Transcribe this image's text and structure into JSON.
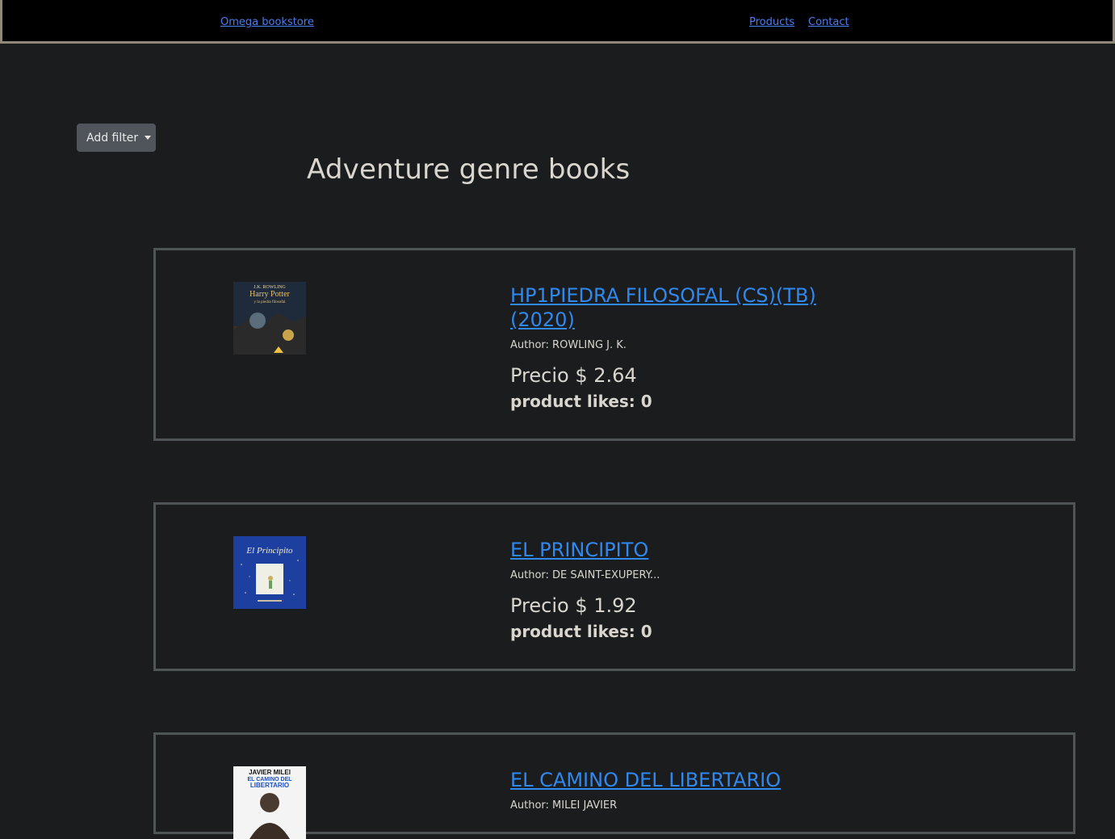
{
  "nav": {
    "brand": "Omega bookstore",
    "links": [
      "Products",
      "Contact"
    ]
  },
  "filter": {
    "label": "Add filter"
  },
  "page_title": "Adventure genre books",
  "books": [
    {
      "title": "HP1PIEDRA FILOSOFAL (CS)(TB)(2020)",
      "author": "Author: ROWLING J. K.",
      "price": "Precio $ 2.64",
      "likes": "product likes: 0"
    },
    {
      "title": "EL PRINCIPITO",
      "author": "Author: DE SAINT-EXUPERY...",
      "price": "Precio $ 1.92",
      "likes": "product likes: 0"
    },
    {
      "title": "EL CAMINO DEL LIBERTARIO",
      "author": "Author: MILEI JAVIER",
      "price": "",
      "likes": ""
    }
  ],
  "covers": {
    "harry_potter": {
      "line1": "J.K. ROWLING",
      "line2": "Harry Potter",
      "line3": "y la piedra filosofal"
    },
    "principito": {
      "title": "El Principito"
    },
    "libertario": {
      "line1": "JAVIER MILEI",
      "line2": "EL CAMINO DEL",
      "line3": "LIBERTARIO"
    }
  },
  "colors": {
    "background": "#1b1c1e",
    "link": "#2f89ee",
    "card_border": "#4f5457"
  }
}
